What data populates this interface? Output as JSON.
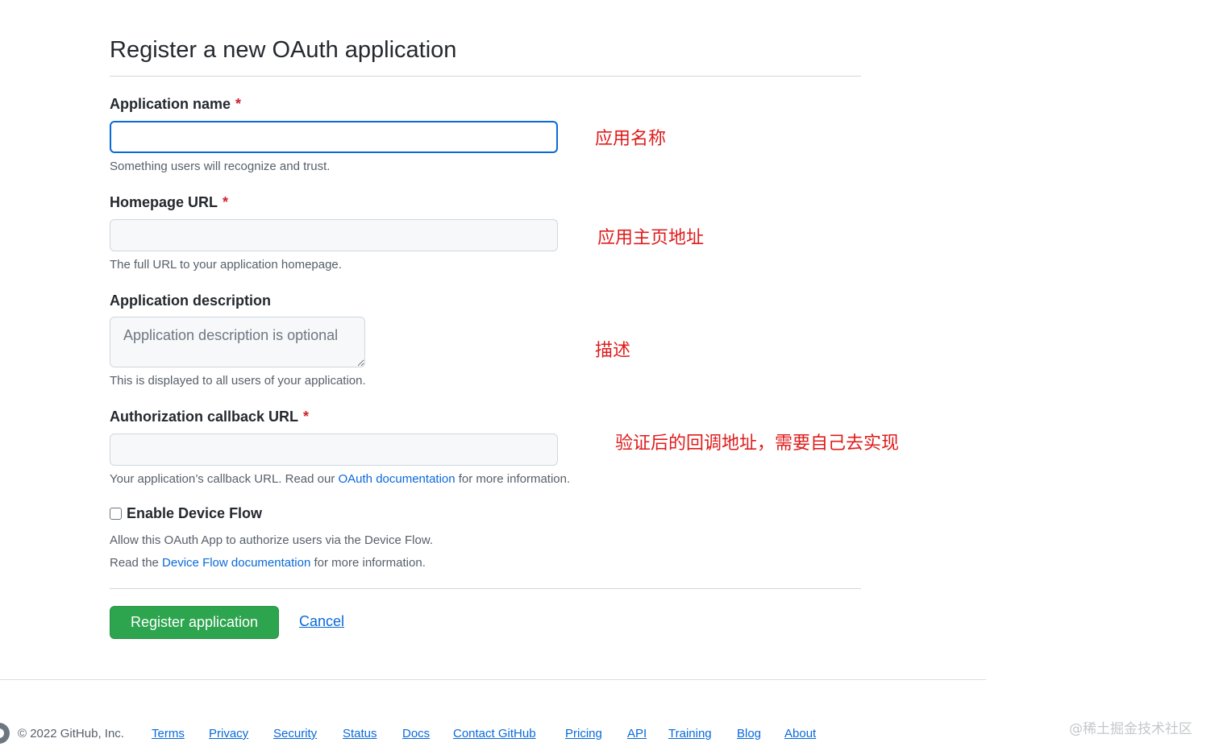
{
  "form": {
    "title": "Register a new OAuth application",
    "app_name": {
      "label": "Application name",
      "required_mark": "*",
      "value": "",
      "note": "Something users will recognize and trust."
    },
    "homepage": {
      "label": "Homepage URL",
      "required_mark": "*",
      "value": "",
      "note": "The full URL to your application homepage."
    },
    "description": {
      "label": "Application description",
      "placeholder": "Application description is optional",
      "note": "This is displayed to all users of your application."
    },
    "callback": {
      "label": "Authorization callback URL",
      "required_mark": "*",
      "value": "",
      "note_prefix": "Your application’s callback URL. Read our ",
      "note_link": "OAuth documentation",
      "note_suffix": " for more information."
    },
    "device_flow": {
      "label": "Enable Device Flow",
      "checked": false,
      "note_line1": "Allow this OAuth App to authorize users via the Device Flow.",
      "note2_prefix": "Read the ",
      "note2_link": "Device Flow documentation",
      "note2_suffix": " for more information."
    },
    "submit_label": "Register application",
    "cancel_label": "Cancel"
  },
  "annotations": {
    "app_name": "应用名称",
    "homepage": "应用主页地址",
    "description": "描述",
    "callback": "验证后的回调地址，需要自己去实现"
  },
  "footer": {
    "copyright": "© 2022 GitHub, Inc.",
    "links": [
      "Terms",
      "Privacy",
      "Security",
      "Status",
      "Docs",
      "Contact GitHub",
      "Pricing",
      "API",
      "Training",
      "Blog",
      "About"
    ]
  },
  "watermark": "@稀土掘金技术社区",
  "colors": {
    "primary_button": "#2da44e",
    "link": "#0969da",
    "required": "#cf222e",
    "annotation": "#e01b1b",
    "focus_border": "#0969da"
  }
}
